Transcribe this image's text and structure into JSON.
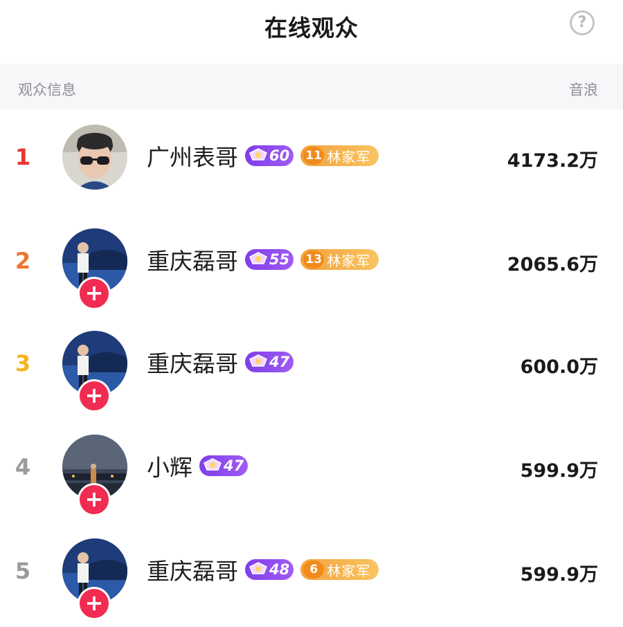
{
  "header": {
    "title": "在线观众",
    "help_glyph": "?"
  },
  "columns": {
    "left": "观众信息",
    "right": "音浪"
  },
  "colors": {
    "rank1": "#e8352f",
    "rank2": "#f0742b",
    "rank3": "#f6b31b",
    "rank_other": "#9b9b9b",
    "follow_button": "#f02c52",
    "level_badge": "#8a46ee",
    "fan_badge": "#f5ab46"
  },
  "viewers": [
    {
      "rank": "1",
      "name": "广州表哥",
      "level": "60",
      "fan_level": "11",
      "fan_club": "林家军",
      "amount": "4173.2万",
      "followable": false,
      "avatar_icon": "man-sunglasses-avatar"
    },
    {
      "rank": "2",
      "name": "重庆磊哥",
      "level": "55",
      "fan_level": "13",
      "fan_club": "林家军",
      "amount": "2065.6万",
      "followable": true,
      "avatar_icon": "man-car-avatar"
    },
    {
      "rank": "3",
      "name": "重庆磊哥",
      "level": "47",
      "fan_level": "",
      "fan_club": "",
      "amount": "600.0万",
      "followable": true,
      "avatar_icon": "man-car-avatar"
    },
    {
      "rank": "4",
      "name": "小辉",
      "level": "47",
      "fan_level": "",
      "fan_club": "",
      "amount": "599.9万",
      "followable": true,
      "avatar_icon": "night-scene-avatar"
    },
    {
      "rank": "5",
      "name": "重庆磊哥",
      "level": "48",
      "fan_level": "6",
      "fan_club": "林家军",
      "amount": "599.9万",
      "followable": true,
      "avatar_icon": "man-car-avatar"
    }
  ],
  "follow_glyph": "+"
}
